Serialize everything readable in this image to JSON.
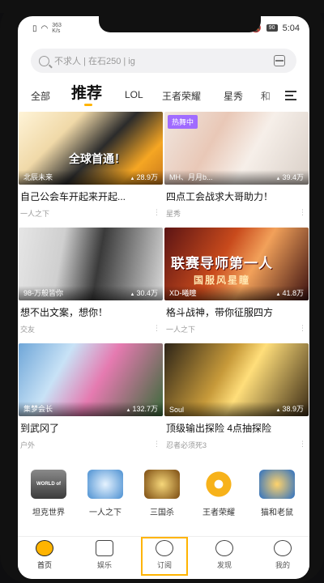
{
  "status": {
    "net_speed": "363",
    "net_unit": "K/s",
    "battery": "90",
    "time": "5:04"
  },
  "search": {
    "placeholder": "不求人 | 在石250 | ig"
  },
  "tabs": [
    {
      "label": "全部"
    },
    {
      "label": "推荐"
    },
    {
      "label": "LOL"
    },
    {
      "label": "王者荣耀"
    },
    {
      "label": "星秀"
    },
    {
      "label": "和"
    }
  ],
  "cards": [
    {
      "host": "北辰未来",
      "viewers": "28.9万",
      "title": "自己公会车开起来开起...",
      "category": "一人之下",
      "banner": "全球首通！"
    },
    {
      "host": "MH、月月b...",
      "viewers": "39.4万",
      "title": "四点工会战求大哥助力！",
      "category": "星秀",
      "badge": "热舞中"
    },
    {
      "host": "98-万般皆你",
      "viewers": "30.4万",
      "title": "想不出文案，想你！",
      "category": "交友"
    },
    {
      "host": "XD-曦瞳",
      "viewers": "41.8万",
      "title": "格斗战神，带你征服四方",
      "category": "一人之下",
      "banner": "联赛导师第一人",
      "banner_sub": "国服风星瞳"
    },
    {
      "host": "集梦会长",
      "viewers": "132.7万",
      "title": "到武冈了",
      "category": "户外"
    },
    {
      "host": "Soul",
      "viewers": "38.9万",
      "title": "顶级输出探险 4点抽探险",
      "category": "忍者必须死3"
    }
  ],
  "games": [
    {
      "name": "坦克世界",
      "logo_text": "WORLD of TANKS"
    },
    {
      "name": "一人之下"
    },
    {
      "name": "三国杀"
    },
    {
      "name": "王者荣耀"
    },
    {
      "name": "猫和老鼠"
    }
  ],
  "nav": [
    {
      "label": "首页"
    },
    {
      "label": "娱乐"
    },
    {
      "label": "订阅"
    },
    {
      "label": "发现"
    },
    {
      "label": "我的"
    }
  ]
}
